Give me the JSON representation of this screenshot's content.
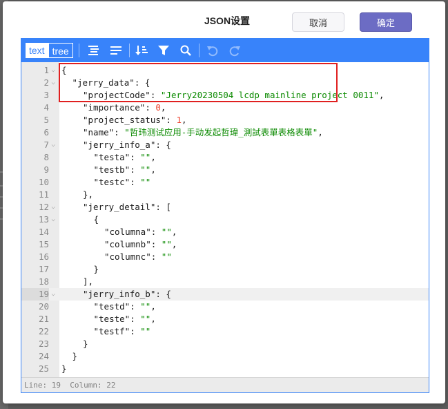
{
  "dialog": {
    "title": "JSON设置",
    "cancel_label": "取消",
    "ok_label": "确定"
  },
  "toolbar": {
    "modes": [
      "text",
      "tree"
    ],
    "active_mode": "text",
    "icons": [
      "format-icon",
      "compact-icon",
      "sort-icon",
      "filter-icon",
      "search-icon",
      "undo-icon",
      "redo-icon"
    ]
  },
  "editor": {
    "lines": [
      {
        "n": "1",
        "fold": true,
        "indent": 0,
        "text": "{"
      },
      {
        "n": "2",
        "fold": true,
        "indent": 1,
        "key": "jerry_data",
        "after": ": {"
      },
      {
        "n": "3",
        "indent": 2,
        "key": "projectCode",
        "str": "Jerry20230504 lcdp mainline project 0011",
        "after": ","
      },
      {
        "n": "4",
        "indent": 2,
        "key": "importance",
        "num": "0",
        "after": ","
      },
      {
        "n": "5",
        "indent": 2,
        "key": "project_status",
        "num": "1",
        "after": ","
      },
      {
        "n": "6",
        "indent": 2,
        "key": "name",
        "str": "哲玮测试应用-手动发起哲瑋_測試表單表格表單",
        "after": ","
      },
      {
        "n": "7",
        "fold": true,
        "indent": 2,
        "key": "jerry_info_a",
        "after": ": {"
      },
      {
        "n": "8",
        "indent": 3,
        "key": "testa",
        "str": "",
        "after": ","
      },
      {
        "n": "9",
        "indent": 3,
        "key": "testb",
        "str": "",
        "after": ","
      },
      {
        "n": "10",
        "indent": 3,
        "key": "testc",
        "str": "",
        "after": ""
      },
      {
        "n": "11",
        "indent": 2,
        "text": "},"
      },
      {
        "n": "12",
        "fold": true,
        "indent": 2,
        "key": "jerry_detail",
        "after": ": ["
      },
      {
        "n": "13",
        "fold": true,
        "indent": 3,
        "text": "{"
      },
      {
        "n": "14",
        "indent": 4,
        "key": "columna",
        "str": "",
        "after": ","
      },
      {
        "n": "15",
        "indent": 4,
        "key": "columnb",
        "str": "",
        "after": ","
      },
      {
        "n": "16",
        "indent": 4,
        "key": "columnc",
        "str": "",
        "after": ""
      },
      {
        "n": "17",
        "indent": 3,
        "text": "}"
      },
      {
        "n": "18",
        "indent": 2,
        "text": "],"
      },
      {
        "n": "19",
        "fold": true,
        "indent": 2,
        "key": "jerry_info_b",
        "after": ": {",
        "active": true
      },
      {
        "n": "20",
        "indent": 3,
        "key": "testd",
        "str": "",
        "after": ","
      },
      {
        "n": "21",
        "indent": 3,
        "key": "teste",
        "str": "",
        "after": ","
      },
      {
        "n": "22",
        "indent": 3,
        "key": "testf",
        "str": "",
        "after": ""
      },
      {
        "n": "23",
        "indent": 2,
        "text": "}"
      },
      {
        "n": "24",
        "indent": 1,
        "text": "}"
      },
      {
        "n": "25",
        "indent": 0,
        "text": "}"
      }
    ],
    "status": "Line: 19  Column: 22"
  },
  "colors": {
    "accent": "#3883fa",
    "string": "#0b8a00",
    "number": "#ee422e",
    "highlight": "#e02020",
    "ok_button": "#6c6cc4"
  }
}
